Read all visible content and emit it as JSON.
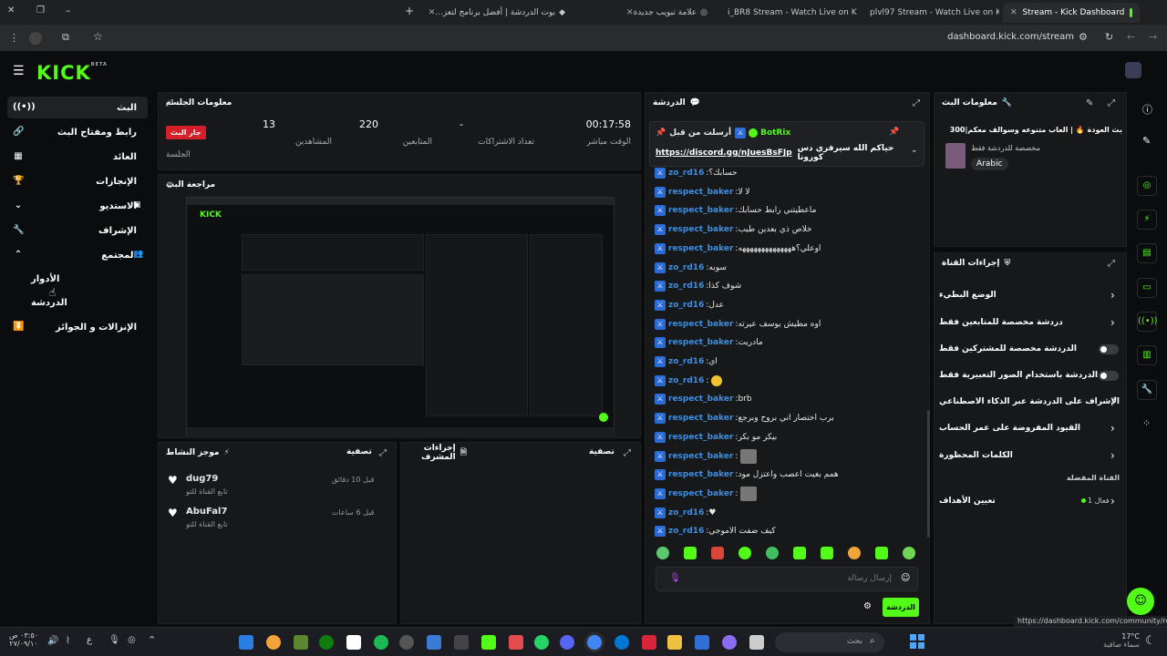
{
  "browser": {
    "tabs": [
      {
        "label": "بوت الدردشة | أفضل برنامج لتعز..."
      },
      {
        "label": "علامة تبويب جديدة"
      },
      {
        "label": "i_BR8 Stream - Watch Live on K"
      },
      {
        "label": "plvl97 Stream - Watch Live on K"
      },
      {
        "label": "Stream - Kick Dashboard"
      }
    ],
    "address": "dashboard.kick.com/stream",
    "status_url": "https://dashboard.kick.com/community/roles"
  },
  "brand": {
    "logo": "KICK",
    "beta": "BETA",
    "accent": "#53fc18"
  },
  "sidebar": {
    "items": [
      {
        "label": "البث",
        "icon": "broadcast-icon"
      },
      {
        "label": "رابط ومفتاح البث",
        "icon": "link-icon"
      },
      {
        "label": "العائد",
        "icon": "revenue-icon"
      },
      {
        "label": "الإنجازات",
        "icon": "trophy-icon"
      },
      {
        "label": "الاستديو",
        "icon": "studio-icon"
      },
      {
        "label": "الإشراف",
        "icon": "wrench-icon"
      },
      {
        "label": "المجتمع",
        "icon": "community-icon"
      },
      {
        "label": "الأدوار"
      },
      {
        "label": "الدردشة"
      },
      {
        "label": "الإنزالات و الجوائز",
        "icon": "drops-icon"
      }
    ]
  },
  "session": {
    "title": "معلومات الجلسة",
    "live_badge": "جار البث",
    "stats": [
      {
        "value": "00:17:58",
        "label": "الوقت مباشر"
      },
      {
        "value": "-",
        "label": "تعداد الاشتراكات"
      },
      {
        "value": "220",
        "label": "المتابعين"
      },
      {
        "value": "13",
        "label": "المشاهدين"
      },
      {
        "value": "",
        "label": "الجلسة"
      }
    ]
  },
  "preview": {
    "title": "مراجعة البث"
  },
  "activity": {
    "title": "موجز النشاط",
    "filter": "تصفية",
    "items": [
      {
        "name": "dug79",
        "sub": "تابع القناة للتو",
        "time": "قبل 10 دقائق"
      },
      {
        "name": "AbuFal7",
        "sub": "تابع القناة للتو",
        "time": "قبل 6 ساعات"
      }
    ]
  },
  "mod_actions": {
    "title": "إجراءات المشرف",
    "filter": "تصفية"
  },
  "chat": {
    "title": "الدردشة",
    "pinned_by": "أرسلت من قبل",
    "pinned_user": "BotRix",
    "pinned_text": "حياكم الله سيرفري دس كورونا",
    "pinned_link": "https://discord.gg/nJuesBsFJp",
    "messages": [
      {
        "user": "zo_rd16",
        "text": "حسابك؟"
      },
      {
        "user": "respect_baker",
        "text": "لا لا"
      },
      {
        "user": "respect_baker",
        "text": "ماعطيتني رابط حسابك"
      },
      {
        "user": "respect_baker",
        "text": "خلاص ذي بعدين طيب"
      },
      {
        "user": "respect_baker",
        "text": "اوعلي؟ههههههههههههههه"
      },
      {
        "user": "zo_rd16",
        "text": "سوبه"
      },
      {
        "user": "zo_rd16",
        "text": "شوف كذا"
      },
      {
        "user": "zo_rd16",
        "text": "عدل"
      },
      {
        "user": "respect_baker",
        "text": "اوه مطيش يوسف عيرته"
      },
      {
        "user": "respect_baker",
        "text": "مادريت"
      },
      {
        "user": "zo_rd16",
        "text": "اي"
      },
      {
        "user": "zo_rd16",
        "text": ""
      },
      {
        "user": "respect_baker",
        "text": "brb"
      },
      {
        "user": "respect_baker",
        "text": "برب اختصار اني بروح وبرجع"
      },
      {
        "user": "respect_baker",
        "text": "بيكر مو بكر"
      },
      {
        "user": "respect_baker",
        "text": ""
      },
      {
        "user": "respect_baker",
        "text": "همم بغيت اعصب واعتزل مود"
      },
      {
        "user": "respect_baker",
        "text": ""
      },
      {
        "user": "zo_rd16",
        "text": "♥"
      },
      {
        "user": "zo_rd16",
        "text": "كيف ضفت الاموجي"
      }
    ],
    "input_placeholder": "إرسال رسالة",
    "send_label": "الدردشة"
  },
  "stream_info": {
    "title": "معلومات البث",
    "stream_title": "بث العودة 🔥 | العاب متنوعه وسوالف معكم|300",
    "subtitle": "مخصصة للدردشة فقط",
    "tag": "Arabic"
  },
  "channel_actions": {
    "title": "إجراءات القناة",
    "rows": [
      {
        "label": "الوضع البطيء",
        "type": "chevron"
      },
      {
        "label": "دردشة مخصصة للمتابعين فقط",
        "type": "chevron"
      },
      {
        "label": "الدردشة مخصصة للمشتركين فقط",
        "type": "toggle"
      },
      {
        "label": "الدردشة باستخدام الصور التعبيرية فقط",
        "type": "toggle"
      },
      {
        "label": "الإشراف على الدردشة عبر الذكاء الاصطناعي",
        "type": "external"
      },
      {
        "label": "القيود المفروضة على عمر الحساب",
        "type": "chevron"
      },
      {
        "label": "الكلمات المحظورة",
        "type": "chevron"
      }
    ],
    "favorite_section": "القناة المفضلة",
    "goals_label": "تعيين الأهداف",
    "goals_status": "فعال 1"
  },
  "taskbar": {
    "time": "٠٣:٥٠ ص",
    "date": "٢٧/٠٩/١٠",
    "weather_temp": "17°C",
    "weather_text": "سماء صافية",
    "search_placeholder": "بحث",
    "lang": "ع"
  }
}
